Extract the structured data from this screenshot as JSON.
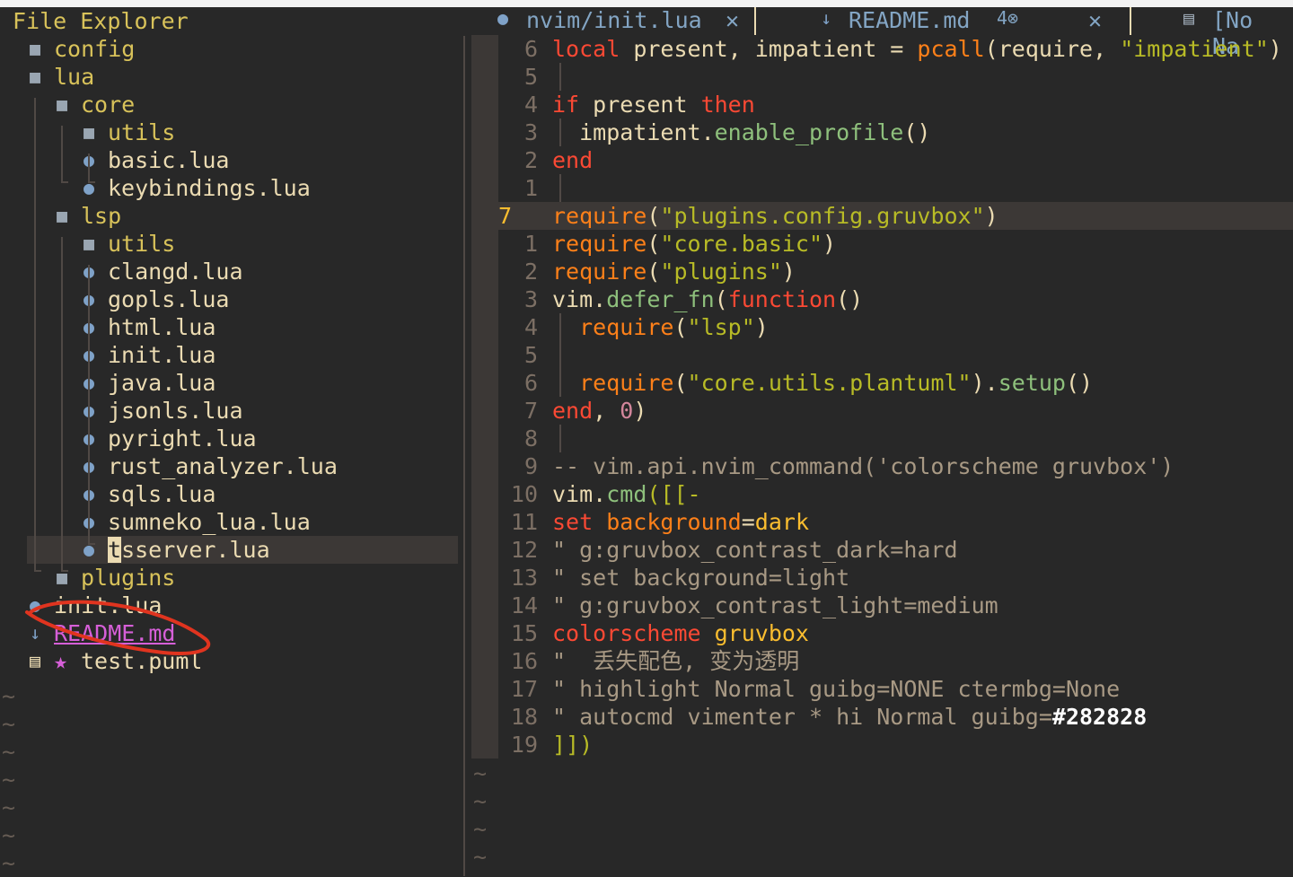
{
  "explorer": {
    "title": "File Explorer",
    "items": [
      {
        "name": "config",
        "kind": "dir",
        "icon": "folder-icon"
      },
      {
        "name": "lua",
        "kind": "dir",
        "icon": "folder-open-icon"
      },
      {
        "name": "core",
        "kind": "dir",
        "icon": "folder-open-icon"
      },
      {
        "name": "utils",
        "kind": "dir",
        "icon": "folder-icon"
      },
      {
        "name": "basic.lua",
        "kind": "file",
        "icon": "lua-icon"
      },
      {
        "name": "keybindings.lua",
        "kind": "file",
        "icon": "lua-icon"
      },
      {
        "name": "lsp",
        "kind": "dir",
        "icon": "folder-open-icon"
      },
      {
        "name": "utils",
        "kind": "dir",
        "icon": "folder-icon"
      },
      {
        "name": "clangd.lua",
        "kind": "file",
        "icon": "lua-icon"
      },
      {
        "name": "gopls.lua",
        "kind": "file",
        "icon": "lua-icon"
      },
      {
        "name": "html.lua",
        "kind": "file",
        "icon": "lua-icon"
      },
      {
        "name": "init.lua",
        "kind": "file",
        "icon": "lua-icon"
      },
      {
        "name": "java.lua",
        "kind": "file",
        "icon": "lua-icon"
      },
      {
        "name": "jsonls.lua",
        "kind": "file",
        "icon": "lua-icon"
      },
      {
        "name": "pyright.lua",
        "kind": "file",
        "icon": "lua-icon"
      },
      {
        "name": "rust_analyzer.lua",
        "kind": "file",
        "icon": "lua-icon"
      },
      {
        "name": "sqls.lua",
        "kind": "file",
        "icon": "lua-icon"
      },
      {
        "name": "sumneko_lua.lua",
        "kind": "file",
        "icon": "lua-icon"
      },
      {
        "name_cursor": "t",
        "name_rest": "sserver.lua",
        "kind": "file",
        "icon": "lua-icon"
      },
      {
        "name": "plugins",
        "kind": "dir",
        "icon": "folder-icon"
      },
      {
        "name": "init.lua",
        "kind": "file",
        "icon": "lua-icon"
      },
      {
        "name": "README.md",
        "kind": "file",
        "icon": "markdown-icon"
      },
      {
        "name": "test.puml",
        "kind": "file",
        "icon": "document-icon",
        "badge": "★"
      }
    ],
    "tilde": "~"
  },
  "tabs": [
    {
      "label": "nvim/init.lua",
      "icon": "lua-icon",
      "close": "✕",
      "active": true
    },
    {
      "label": "README.md",
      "icon": "markdown-icon",
      "diag": "4⊗",
      "close": "✕"
    },
    {
      "label": "[No Na",
      "icon": "document-icon"
    }
  ],
  "editor": {
    "tilde": "~",
    "lines": [
      {
        "n": "6",
        "segs": [
          [
            "k",
            "local"
          ],
          [
            "p",
            " present, impatient = "
          ],
          [
            "o",
            "pcall"
          ],
          [
            "p",
            "(require, "
          ],
          [
            "s",
            "\"impatient\""
          ],
          [
            "p",
            ")"
          ]
        ]
      },
      {
        "n": "5",
        "segs": []
      },
      {
        "n": "4",
        "segs": [
          [
            "k",
            "if"
          ],
          [
            "p",
            " present "
          ],
          [
            "k",
            "then"
          ]
        ]
      },
      {
        "n": "3",
        "segs": [
          [
            "p",
            "  impatient."
          ],
          [
            "f",
            "enable_profile"
          ],
          [
            "p",
            "()"
          ]
        ]
      },
      {
        "n": "2",
        "segs": [
          [
            "k",
            "end"
          ]
        ]
      },
      {
        "n": "1",
        "segs": []
      },
      {
        "n": "7",
        "current": true,
        "segs": [
          [
            "o",
            "require"
          ],
          [
            "p",
            "("
          ],
          [
            "s",
            "\"plugins.config.gruvbox\""
          ],
          [
            "p",
            ")"
          ]
        ]
      },
      {
        "n": "1",
        "segs": [
          [
            "o",
            "require"
          ],
          [
            "p",
            "("
          ],
          [
            "s",
            "\"core.basic\""
          ],
          [
            "p",
            ")"
          ]
        ]
      },
      {
        "n": "2",
        "segs": [
          [
            "o",
            "require"
          ],
          [
            "p",
            "("
          ],
          [
            "s",
            "\"plugins\""
          ],
          [
            "p",
            ")"
          ]
        ]
      },
      {
        "n": "3",
        "segs": [
          [
            "p",
            "vim."
          ],
          [
            "f",
            "defer_fn"
          ],
          [
            "p",
            "("
          ],
          [
            "k",
            "function"
          ],
          [
            "p",
            "()"
          ]
        ]
      },
      {
        "n": "4",
        "segs": [
          [
            "o",
            "  require"
          ],
          [
            "p",
            "("
          ],
          [
            "s",
            "\"lsp\""
          ],
          [
            "p",
            ")"
          ]
        ]
      },
      {
        "n": "5",
        "segs": []
      },
      {
        "n": "6",
        "segs": [
          [
            "o",
            "  require"
          ],
          [
            "p",
            "("
          ],
          [
            "s",
            "\"core.utils.plantuml\""
          ],
          [
            "p",
            ")."
          ],
          [
            "f",
            "setup"
          ],
          [
            "p",
            "()"
          ]
        ]
      },
      {
        "n": "7",
        "segs": [
          [
            "k",
            "end"
          ],
          [
            "p",
            ", "
          ],
          [
            "m",
            "0"
          ],
          [
            "p",
            ")"
          ]
        ]
      },
      {
        "n": "8",
        "segs": []
      },
      {
        "n": "9",
        "segs": [
          [
            "c",
            "-- vim.api.nvim_command('colorscheme gruvbox')"
          ]
        ]
      },
      {
        "n": "10",
        "segs": [
          [
            "p",
            "vim."
          ],
          [
            "f",
            "cmd"
          ],
          [
            "s",
            "([[-"
          ]
        ]
      },
      {
        "n": "11",
        "segs": [
          [
            "k",
            "set"
          ],
          [
            "o",
            " background"
          ],
          [
            "p",
            "="
          ],
          [
            "y",
            "dark"
          ]
        ]
      },
      {
        "n": "12",
        "segs": [
          [
            "c",
            "\" g:gruvbox_contrast_dark=hard"
          ]
        ]
      },
      {
        "n": "13",
        "segs": [
          [
            "c",
            "\" set background=light"
          ]
        ]
      },
      {
        "n": "14",
        "segs": [
          [
            "c",
            "\" g:gruvbox_contrast_light=medium"
          ]
        ]
      },
      {
        "n": "15",
        "segs": [
          [
            "k",
            "colorscheme"
          ],
          [
            "y",
            " gruvbox"
          ]
        ]
      },
      {
        "n": "16",
        "segs": [
          [
            "c",
            "\"  丢失配色, 变为透明"
          ]
        ]
      },
      {
        "n": "17",
        "segs": [
          [
            "c",
            "\" highlight Normal guibg=NONE ctermbg=None"
          ]
        ]
      },
      {
        "n": "18",
        "segs": [
          [
            "c",
            "\" autocmd vimenter * hi Normal guibg="
          ],
          [
            "w",
            "#282828"
          ]
        ]
      },
      {
        "n": "19",
        "segs": [
          [
            "s",
            "]])"
          ]
        ]
      }
    ]
  }
}
